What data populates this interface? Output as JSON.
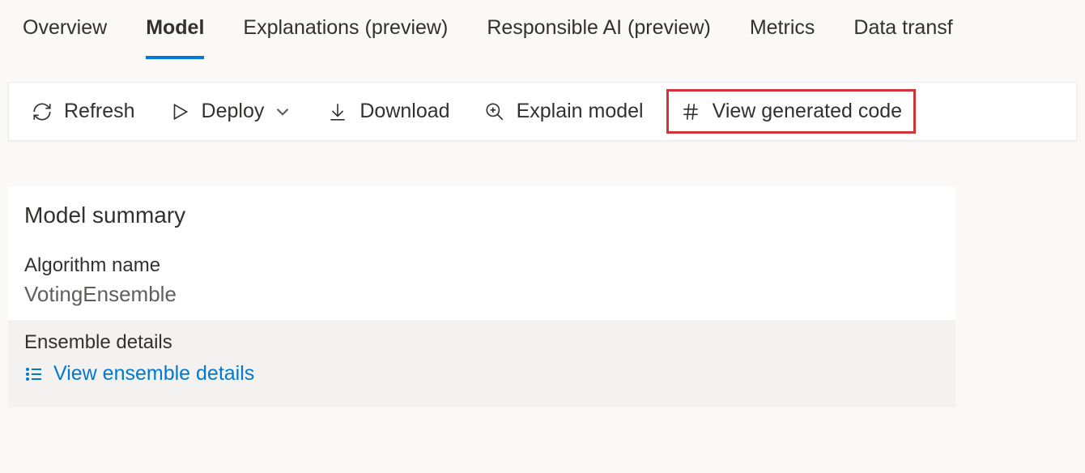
{
  "tabs": {
    "overview": "Overview",
    "model": "Model",
    "explanations": "Explanations (preview)",
    "responsible_ai": "Responsible AI (preview)",
    "metrics": "Metrics",
    "data_transf": "Data transf"
  },
  "toolbar": {
    "refresh": "Refresh",
    "deploy": "Deploy",
    "download": "Download",
    "explain_model": "Explain model",
    "view_generated_code": "View generated code"
  },
  "summary": {
    "title": "Model summary",
    "algorithm_label": "Algorithm name",
    "algorithm_value": "VotingEnsemble",
    "ensemble_title": "Ensemble details",
    "ensemble_link": "View ensemble details"
  }
}
